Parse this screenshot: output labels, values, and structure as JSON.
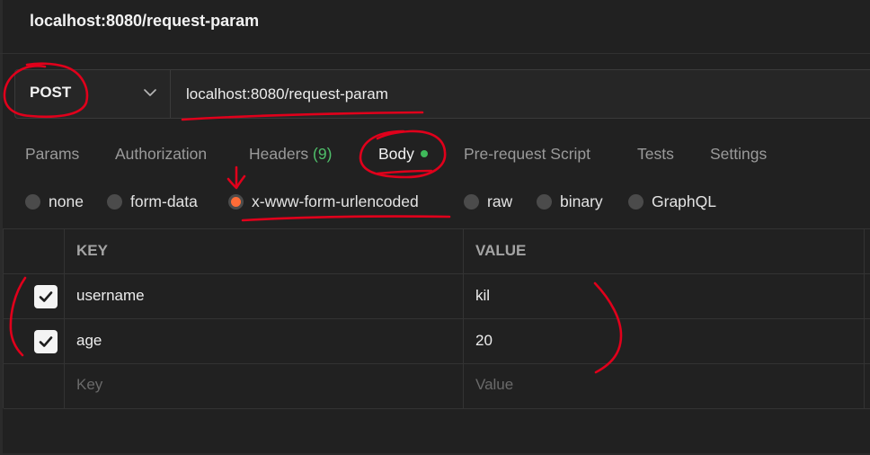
{
  "page": {
    "title": "localhost:8080/request-param"
  },
  "request": {
    "method": "POST",
    "url": "localhost:8080/request-param"
  },
  "tabs": [
    {
      "label": "Params"
    },
    {
      "label": "Authorization"
    },
    {
      "label": "Headers",
      "count": "(9)"
    },
    {
      "label": "Body",
      "active": true
    },
    {
      "label": "Pre-request Script"
    },
    {
      "label": "Tests"
    },
    {
      "label": "Settings"
    }
  ],
  "body_types": [
    {
      "label": "none"
    },
    {
      "label": "form-data"
    },
    {
      "label": "x-www-form-urlencoded",
      "selected": true
    },
    {
      "label": "raw"
    },
    {
      "label": "binary"
    },
    {
      "label": "GraphQL"
    }
  ],
  "table": {
    "headers": {
      "key": "KEY",
      "value": "VALUE"
    },
    "rows": [
      {
        "checked": true,
        "key": "username",
        "value": "kil"
      },
      {
        "checked": true,
        "key": "age",
        "value": "20"
      }
    ],
    "new_row": {
      "key_placeholder": "Key",
      "value_placeholder": "Value"
    }
  },
  "colors": {
    "background": "#212121",
    "accent": "#ff6c37",
    "active_dot": "#3fb95a",
    "annotation": "#e0001b"
  },
  "icons": {
    "method_dropdown": "chevron-down-icon",
    "row_check": "checkmark-icon"
  }
}
